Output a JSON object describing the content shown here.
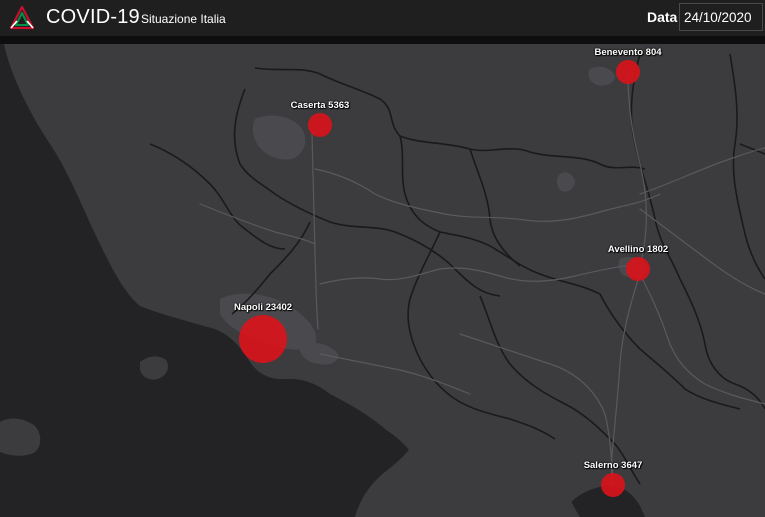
{
  "header": {
    "title": "COVID-19",
    "subtitle": "Situazione Italia",
    "date_label": "Data",
    "date_value": "24/10/2020"
  },
  "colors": {
    "header_bg": "#1f1f1f",
    "land": "#3c3c3f",
    "sea": "#232326",
    "bubble": "#d9141b",
    "logo_red": "#c8102e",
    "logo_green": "#009246"
  },
  "map": {
    "markers": [
      {
        "name": "Caserta",
        "cases": 5363,
        "label": "Caserta 5363"
      },
      {
        "name": "Benevento",
        "cases": 804,
        "label": "Benevento 804"
      },
      {
        "name": "Avellino",
        "cases": 1802,
        "label": "Avellino 1802"
      },
      {
        "name": "Napoli",
        "cases": 23402,
        "label": "Napoli 23402"
      },
      {
        "name": "Salerno",
        "cases": 3647,
        "label": "Salerno 3647"
      }
    ]
  }
}
